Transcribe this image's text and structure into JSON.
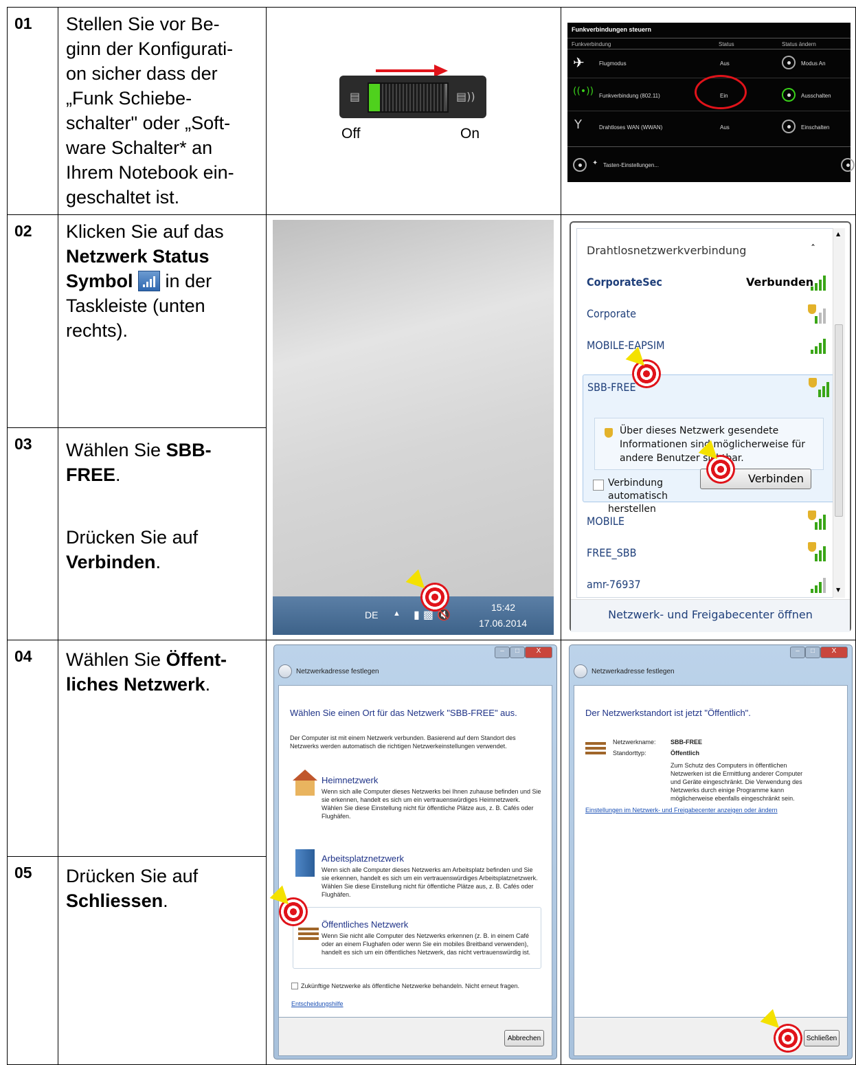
{
  "rows": {
    "r01": {
      "num": "01",
      "text_plain": "Stellen Sie vor Be-ginn der Konfigurati-on sicher dass der „Funk Schiebe-schalter\" oder „Soft-ware Schalter* an Ihrem Notebook ein-geschaltet ist."
    },
    "r02": {
      "num": "02",
      "t1": "Klicken Sie auf das ",
      "b1": "Netzwerk Status Symbol",
      "t2": " in der Taskleiste (unten rechts)."
    },
    "r03": {
      "num": "03",
      "t1": "Wählen Sie ",
      "b1": "SBB-FREE",
      "t2": ".",
      "t3": "Drücken Sie auf ",
      "b2": "Verbinden",
      "t4": "."
    },
    "r04": {
      "num": "04",
      "t1": "Wählen Sie ",
      "b1": "Öffent-liches Netzwerk",
      "t2": "."
    },
    "r05": {
      "num": "05",
      "t1": "Drücken Sie auf ",
      "b1": "Schliessen",
      "t2": "."
    }
  },
  "switch": {
    "off_label": "Off",
    "on_label": "On"
  },
  "funk_panel": {
    "title": "Funkverbindungen steuern",
    "col_connection": "Funkverbindung",
    "col_status": "Status",
    "col_change": "Status ändern",
    "rows": [
      {
        "name": "Flugmodus",
        "status": "Aus",
        "action": "Modus An",
        "icon": "airplane-icon"
      },
      {
        "name": "Funkverbindung (802.11)",
        "status": "Ein",
        "action": "Ausschalten",
        "icon": "wifi-antenna-icon"
      },
      {
        "name": "Drahtloses WAN (WWAN)",
        "status": "Aus",
        "action": "Einschalten",
        "icon": "wwan-antenna-icon"
      }
    ],
    "footer": "Tasten-Einstellungen..."
  },
  "taskbar": {
    "lang": "DE",
    "time": "15:42",
    "date": "17.06.2014"
  },
  "wlan": {
    "header": "Drahtlosnetzwerkverbindung",
    "networks": [
      {
        "name": "CorporateSec",
        "status": "Verbunden"
      },
      {
        "name": "Corporate"
      },
      {
        "name": "MOBILE-EAPSIM"
      },
      {
        "name": "SBB-FREE"
      },
      {
        "name": "MOBILE"
      },
      {
        "name": "FREE_SBB"
      },
      {
        "name": "amr-76937"
      }
    ],
    "warning": "Über dieses Netzwerk gesendete Informationen sind möglicherweise für andere Benutzer sichtbar.",
    "auto_connect": "Verbindung automatisch herstellen",
    "connect_button": "Verbinden",
    "footer_link": "Netzwerk- und Freigabecenter öffnen"
  },
  "dialog1": {
    "nav_title": "Netzwerkadresse festlegen",
    "heading": "Wählen Sie einen Ort für das Netzwerk \"SBB-FREE\" aus.",
    "intro": "Der Computer ist mit einem Netzwerk verbunden. Basierend auf dem Standort des Netzwerks werden automatisch die richtigen Netzwerkeinstellungen verwendet.",
    "options": [
      {
        "title": "Heimnetzwerk",
        "desc": "Wenn sich alle Computer dieses Netzwerks bei Ihnen zuhause befinden und Sie sie erkennen, handelt es sich um ein vertrauenswürdiges Heimnetzwerk. Wählen Sie diese Einstellung nicht für öffentliche Plätze aus, z. B. Cafés oder Flughäfen."
      },
      {
        "title": "Arbeitsplatznetzwerk",
        "desc": "Wenn sich alle Computer dieses Netzwerks am Arbeitsplatz befinden und Sie sie erkennen, handelt es sich um ein vertrauenswürdiges Arbeitsplatznetzwerk. Wählen Sie diese Einstellung nicht für öffentliche Plätze aus, z. B. Cafés oder Flughäfen."
      },
      {
        "title": "Öffentliches Netzwerk",
        "desc": "Wenn Sie nicht alle Computer des Netzwerks erkennen (z. B. in einem Café oder an einem Flughafen oder wenn Sie ein mobiles Breitband verwenden), handelt es sich um ein öffentliches Netzwerk, das nicht vertrauenswürdig ist."
      }
    ],
    "checkbox": "Zukünftige Netzwerke als öffentliche Netzwerke behandeln. Nicht erneut fragen.",
    "help_link": "Entscheidungshilfe",
    "cancel": "Abbrechen"
  },
  "dialog2": {
    "nav_title": "Netzwerkadresse festlegen",
    "heading": "Der Netzwerkstandort ist jetzt \"Öffentlich\".",
    "name_label": "Netzwerkname:",
    "name_value": "SBB-FREE",
    "type_label": "Standorttyp:",
    "type_value": "Öffentlich",
    "desc": "Zum Schutz des Computers in öffentlichen Netzwerken ist die Ermittlung anderer Computer und Geräte eingeschränkt. Die Verwendung des Netzwerks durch einige Programme kann möglicherweise ebenfalls eingeschränkt sein.",
    "link": "Einstellungen im Netzwerk- und Freigabecenter anzeigen oder ändern",
    "close": "Schließen"
  }
}
